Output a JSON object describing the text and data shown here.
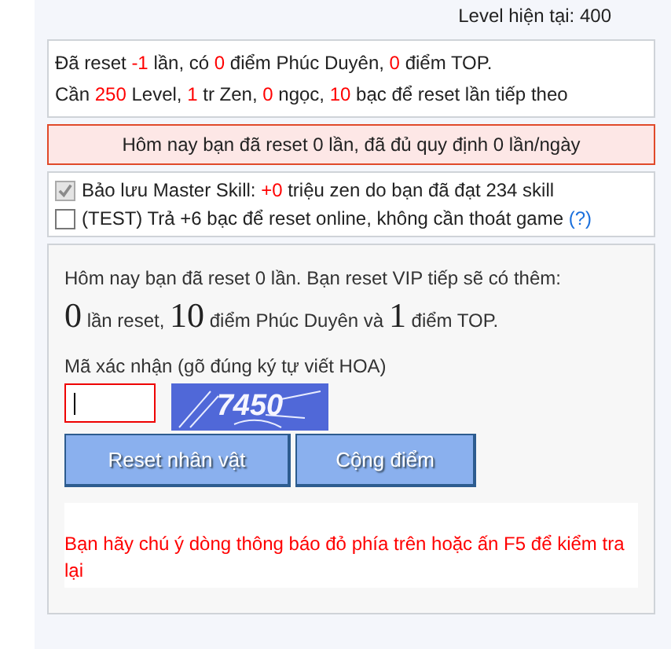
{
  "level_line": "Level hiện tại: 400",
  "status_lines": [
    [
      {
        "text": "Đã reset ",
        "kind": "plain"
      },
      {
        "text": "-1",
        "kind": "value"
      },
      {
        "text": " lần, có ",
        "kind": "plain"
      },
      {
        "text": "0",
        "kind": "value"
      },
      {
        "text": " điểm Phúc Duyên, ",
        "kind": "plain"
      },
      {
        "text": "0",
        "kind": "value"
      },
      {
        "text": " điểm TOP.",
        "kind": "plain"
      }
    ],
    [
      {
        "text": "Cần ",
        "kind": "plain"
      },
      {
        "text": "250",
        "kind": "value"
      },
      {
        "text": " Level, ",
        "kind": "plain"
      },
      {
        "text": "1",
        "kind": "value"
      },
      {
        "text": " tr Zen, ",
        "kind": "plain"
      },
      {
        "text": "0",
        "kind": "value"
      },
      {
        "text": " ngọc, ",
        "kind": "plain"
      },
      {
        "text": "10",
        "kind": "value"
      },
      {
        "text": " bạc để reset lần tiếp theo",
        "kind": "plain"
      }
    ]
  ],
  "alert": "Hôm nay bạn đã reset 0 lần, đã đủ quy định 0 lần/ngày",
  "options": [
    {
      "checked": true,
      "disabled": true,
      "label": [
        {
          "text": "Bảo lưu Master Skill: ",
          "kind": "plain"
        },
        {
          "text": "+0",
          "kind": "value"
        },
        {
          "text": " triệu zen do bạn đã đạt 234 skill",
          "kind": "plain"
        }
      ]
    },
    {
      "checked": false,
      "disabled": false,
      "label": [
        {
          "text": "(TEST) Trả +6 bạc để reset online, không cần thoát game ",
          "kind": "plain"
        }
      ],
      "help_link": "(?)"
    }
  ],
  "vip": {
    "intro": "Hôm nay bạn đã reset 0 lần. Bạn reset VIP tiếp sẽ có thêm:",
    "summary": [
      {
        "text": "0",
        "kind": "big"
      },
      {
        "text": " lần reset, ",
        "kind": "plain"
      },
      {
        "text": "10",
        "kind": "big"
      },
      {
        "text": " điểm Phúc Duyên và ",
        "kind": "plain"
      },
      {
        "text": "1",
        "kind": "big"
      },
      {
        "text": " điểm TOP.",
        "kind": "plain"
      }
    ],
    "captcha_label": "Mã xác nhận (gõ đúng ký tự viết HOA)",
    "captcha_text": "7450",
    "buttons": [
      "Reset nhân vật",
      "Cộng điểm"
    ],
    "notice": "Bạn hãy chú ý dòng thông báo đỏ phía trên hoặc ấn F5 để kiểm tra lại"
  }
}
